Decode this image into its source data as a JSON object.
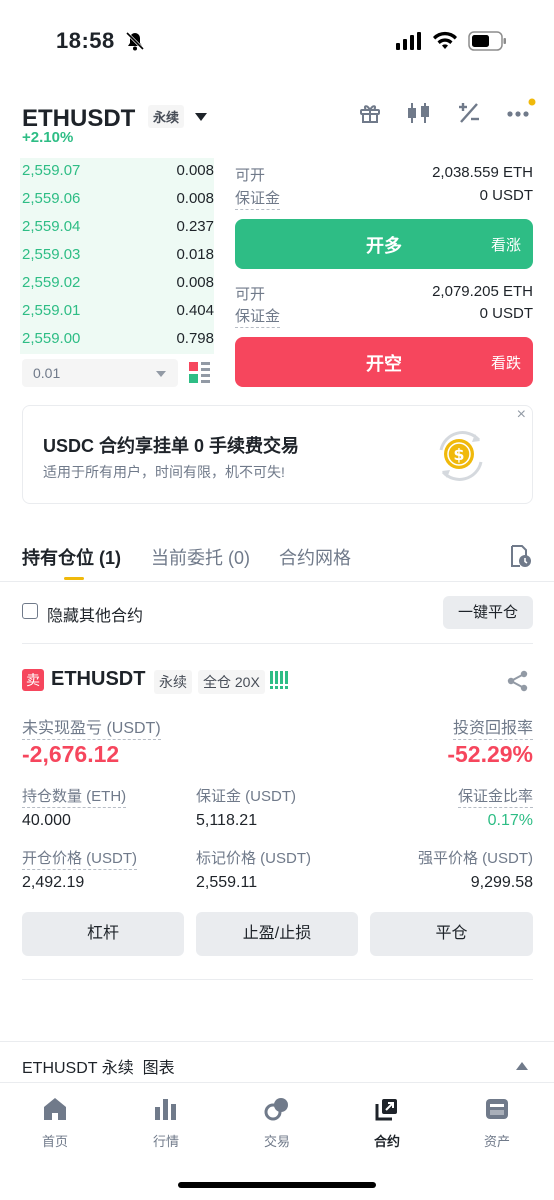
{
  "status": {
    "time": "18:58"
  },
  "header": {
    "symbol": "ETHUSDT",
    "contract_type": "永续",
    "change": "+2.10%"
  },
  "order_book": {
    "rows": [
      {
        "price": "2,559.07",
        "qty": "0.008"
      },
      {
        "price": "2,559.06",
        "qty": "0.008"
      },
      {
        "price": "2,559.04",
        "qty": "0.237"
      },
      {
        "price": "2,559.03",
        "qty": "0.018"
      },
      {
        "price": "2,559.02",
        "qty": "0.008"
      },
      {
        "price": "2,559.01",
        "qty": "0.404"
      },
      {
        "price": "2,559.00",
        "qty": "0.798"
      }
    ],
    "precision": "0.01"
  },
  "long": {
    "available_label": "可开",
    "available_value": "2,038.559 ETH",
    "margin_label": "保证金",
    "margin_value": "0 USDT",
    "button_label": "开多",
    "button_sub": "看涨"
  },
  "short": {
    "available_label": "可开",
    "available_value": "2,079.205 ETH",
    "margin_label": "保证金",
    "margin_value": "0 USDT",
    "button_label": "开空",
    "button_sub": "看跌"
  },
  "promo": {
    "title": "USDC 合约享挂单 0 手续费交易",
    "subtitle": "适用于所有用户，时间有限，机不可失!",
    "close": "×"
  },
  "tabs": {
    "positions": "持有仓位 (1)",
    "orders": "当前委托 (0)",
    "grid": "合约网格"
  },
  "filter": {
    "hide_label": "隐藏其他合约",
    "close_all": "一键平仓"
  },
  "position": {
    "side": "卖",
    "symbol": "ETHUSDT",
    "contract_type": "永续",
    "margin_mode": "全仓 20X",
    "pnl_label": "未实现盈亏 (USDT)",
    "pnl_value": "-2,676.12",
    "roi_label": "投资回报率",
    "roi_value": "-52.29%",
    "size_label": "持仓数量 (ETH)",
    "size_value": "40.000",
    "margin_label": "保证金 (USDT)",
    "margin_value": "5,118.21",
    "margin_ratio_label": "保证金比率",
    "margin_ratio_value": "0.17%",
    "entry_label": "开仓价格 (USDT)",
    "entry_value": "2,492.19",
    "mark_label": "标记价格 (USDT)",
    "mark_value": "2,559.11",
    "liq_label": "强平价格 (USDT)",
    "liq_value": "9,299.58",
    "btn_leverage": "杠杆",
    "btn_tpsl": "止盈/止损",
    "btn_close": "平仓"
  },
  "chart_bar": {
    "label": "ETHUSDT 永续  图表"
  },
  "nav": [
    {
      "label": "首页",
      "icon": "home-icon"
    },
    {
      "label": "行情",
      "icon": "markets-icon"
    },
    {
      "label": "交易",
      "icon": "trade-icon"
    },
    {
      "label": "合约",
      "icon": "futures-icon"
    },
    {
      "label": "资产",
      "icon": "wallet-icon"
    }
  ],
  "colors": {
    "green": "#2ebd85",
    "red": "#f6465d",
    "accent": "#f0b90b"
  }
}
